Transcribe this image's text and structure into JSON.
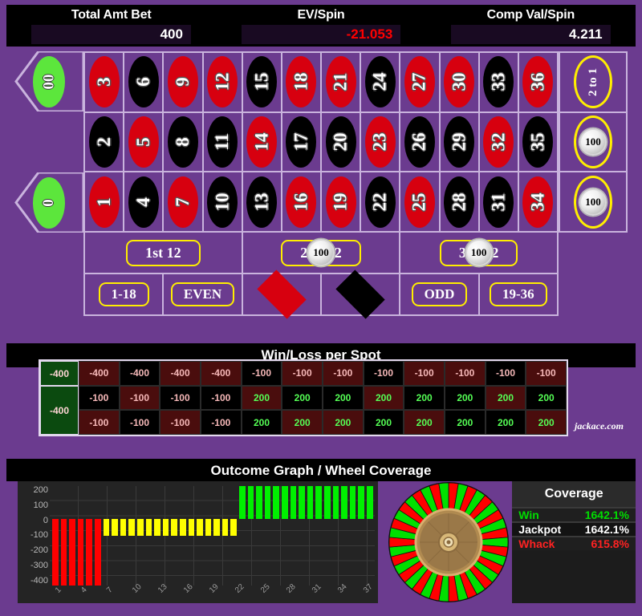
{
  "header": {
    "stats": [
      {
        "label": "Total Amt Bet",
        "value": "400",
        "negative": false
      },
      {
        "label": "EV/Spin",
        "value": "-21.053",
        "negative": true
      },
      {
        "label": "Comp Val/Spin",
        "value": "4.211",
        "negative": false
      }
    ]
  },
  "board": {
    "zeros": [
      {
        "label": "00",
        "chip": null
      },
      {
        "label": "0",
        "chip": null
      }
    ],
    "numbers": [
      {
        "n": "3",
        "color": "red"
      },
      {
        "n": "6",
        "color": "black"
      },
      {
        "n": "9",
        "color": "red"
      },
      {
        "n": "12",
        "color": "red"
      },
      {
        "n": "15",
        "color": "black"
      },
      {
        "n": "18",
        "color": "red"
      },
      {
        "n": "21",
        "color": "red"
      },
      {
        "n": "24",
        "color": "black"
      },
      {
        "n": "27",
        "color": "red"
      },
      {
        "n": "30",
        "color": "red"
      },
      {
        "n": "33",
        "color": "black"
      },
      {
        "n": "36",
        "color": "red"
      },
      {
        "n": "2",
        "color": "black"
      },
      {
        "n": "5",
        "color": "red"
      },
      {
        "n": "8",
        "color": "black"
      },
      {
        "n": "11",
        "color": "black"
      },
      {
        "n": "14",
        "color": "red"
      },
      {
        "n": "17",
        "color": "black"
      },
      {
        "n": "20",
        "color": "black"
      },
      {
        "n": "23",
        "color": "red"
      },
      {
        "n": "26",
        "color": "black"
      },
      {
        "n": "29",
        "color": "black"
      },
      {
        "n": "32",
        "color": "red"
      },
      {
        "n": "35",
        "color": "black"
      },
      {
        "n": "1",
        "color": "red"
      },
      {
        "n": "4",
        "color": "black"
      },
      {
        "n": "7",
        "color": "red"
      },
      {
        "n": "10",
        "color": "black"
      },
      {
        "n": "13",
        "color": "black"
      },
      {
        "n": "16",
        "color": "red"
      },
      {
        "n": "19",
        "color": "red"
      },
      {
        "n": "22",
        "color": "black"
      },
      {
        "n": "25",
        "color": "red"
      },
      {
        "n": "28",
        "color": "black"
      },
      {
        "n": "31",
        "color": "black"
      },
      {
        "n": "34",
        "color": "red"
      }
    ],
    "column_bets": [
      {
        "label": "2 to 1",
        "chip": null
      },
      {
        "label": "2 to 1",
        "chip": "100"
      },
      {
        "label": "2 to 1",
        "chip": "100"
      }
    ],
    "dozen_bets": [
      {
        "label": "1st 12",
        "chip": null
      },
      {
        "label": "2nd 12",
        "chip": "100"
      },
      {
        "label": "3rd 12",
        "chip": "100"
      }
    ],
    "outside_bets": [
      {
        "label": "1-18",
        "kind": "text",
        "chip": null
      },
      {
        "label": "EVEN",
        "kind": "text",
        "chip": null
      },
      {
        "label": "RED",
        "kind": "diamond-red",
        "chip": null
      },
      {
        "label": "BLACK",
        "kind": "diamond-black",
        "chip": null
      },
      {
        "label": "ODD",
        "kind": "text",
        "chip": null
      },
      {
        "label": "19-36",
        "kind": "text",
        "chip": null
      }
    ]
  },
  "winloss": {
    "title": "Win/Loss per Spot",
    "watermark": "jackace.com",
    "zero_cells": [
      {
        "label": "00",
        "value": "-400"
      },
      {
        "label": "0",
        "value": "-400"
      }
    ],
    "values": [
      "-400",
      "-400",
      "-400",
      "-400",
      "-100",
      "-100",
      "-100",
      "-100",
      "-100",
      "-100",
      "-100",
      "-100",
      "-100",
      "-100",
      "-100",
      "-100",
      "200",
      "200",
      "200",
      "200",
      "200",
      "200",
      "200",
      "200",
      "-100",
      "-100",
      "-100",
      "-100",
      "200",
      "200",
      "200",
      "200",
      "200",
      "200",
      "200",
      "200"
    ]
  },
  "graph": {
    "title": "Outcome Graph / Wheel Coverage"
  },
  "chart_data": {
    "type": "bar",
    "title": "Outcome Graph / Wheel Coverage",
    "xlabel": "",
    "ylabel": "",
    "ylim": [
      -400,
      200
    ],
    "yticks": [
      "200",
      "100",
      "0",
      "-100",
      "-200",
      "-300",
      "-400"
    ],
    "xticks": [
      "1",
      "4",
      "7",
      "10",
      "13",
      "16",
      "19",
      "22",
      "25",
      "28",
      "31",
      "34",
      "37"
    ],
    "grid": true,
    "legend": "none",
    "x": [
      1,
      2,
      3,
      4,
      5,
      6,
      7,
      8,
      9,
      10,
      11,
      12,
      13,
      14,
      15,
      16,
      17,
      18,
      19,
      20,
      21,
      22,
      23,
      24,
      25,
      26,
      27,
      28,
      29,
      30,
      31,
      32,
      33,
      34,
      35,
      36,
      37,
      38
    ],
    "values": [
      -400,
      -400,
      -400,
      -400,
      -400,
      -400,
      -100,
      -100,
      -100,
      -100,
      -100,
      -100,
      -100,
      -100,
      -100,
      -100,
      -100,
      -100,
      -100,
      -100,
      -100,
      -100,
      200,
      200,
      200,
      200,
      200,
      200,
      200,
      200,
      200,
      200,
      200,
      200,
      200,
      200,
      200,
      200
    ],
    "colors": [
      "red",
      "red",
      "red",
      "red",
      "red",
      "red",
      "yellow",
      "yellow",
      "yellow",
      "yellow",
      "yellow",
      "yellow",
      "yellow",
      "yellow",
      "yellow",
      "yellow",
      "yellow",
      "yellow",
      "yellow",
      "yellow",
      "yellow",
      "yellow",
      "green",
      "green",
      "green",
      "green",
      "green",
      "green",
      "green",
      "green",
      "green",
      "green",
      "green",
      "green",
      "green",
      "green",
      "green",
      "green"
    ],
    "color_hex": {
      "red": "#ff0000",
      "yellow": "#ffff00",
      "green": "#00f000"
    }
  },
  "coverage": {
    "title": "Coverage",
    "rows": [
      {
        "name": "Win",
        "count": "16",
        "pct": "42.1%",
        "style": "win"
      },
      {
        "name": "Jackpot",
        "count": "16",
        "pct": "42.1%",
        "style": "jack"
      },
      {
        "name": "Whack",
        "count": "6",
        "pct": "15.8%",
        "style": "whack"
      }
    ]
  },
  "wheel": {
    "segments": 38,
    "colors": [
      "#ff0000",
      "#00e000"
    ]
  }
}
